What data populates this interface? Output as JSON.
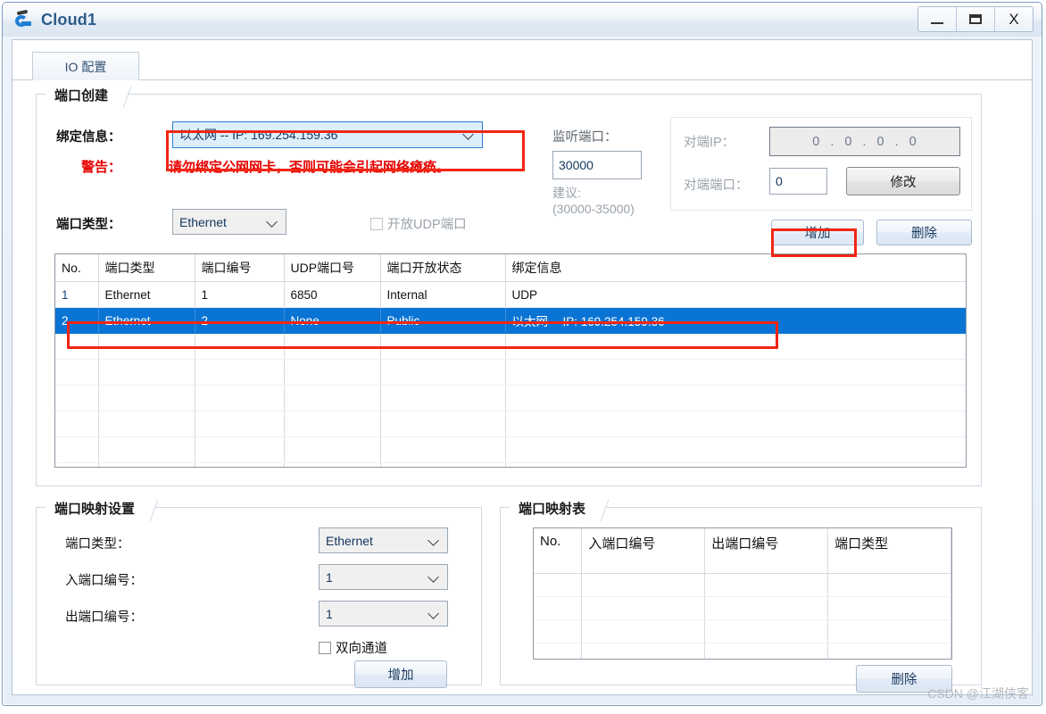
{
  "window": {
    "title": "Cloud1",
    "icon": "cloud-icon",
    "controls": {
      "minimize": "_",
      "maximize": "❐",
      "close": "X"
    }
  },
  "tabs": [
    {
      "label": "IO 配置",
      "active": true
    }
  ],
  "port_create": {
    "title": "端口创建",
    "binding_label": "绑定信息：",
    "binding_value": "以太网 -- IP: 169.254.159.36",
    "warning_label": "警告：",
    "warning_text": "请勿绑定公网网卡，否则可能会引起网络瘫痪。",
    "port_type_label": "端口类型：",
    "port_type_value": "Ethernet",
    "udp_checkbox_label": "开放UDP端口",
    "udp_checkbox_checked": false,
    "listen_port_label": "监听端口：",
    "listen_port_value": "30000",
    "suggest_label": "建议:",
    "suggest_range": "(30000-35000)",
    "peer_ip_label": "对端IP：",
    "peer_ip_octets": [
      "0",
      "0",
      "0",
      "0"
    ],
    "peer_port_label": "对端端口：",
    "peer_port_value": "0",
    "modify_button": "修改",
    "add_button": "增加",
    "delete_button": "删除"
  },
  "port_table": {
    "headers": [
      "No.",
      "端口类型",
      "端口编号",
      "UDP端口号",
      "端口开放状态",
      "绑定信息"
    ],
    "rows": [
      {
        "cells": [
          "1",
          "Ethernet",
          "1",
          "6850",
          "Internal",
          "UDP"
        ],
        "selected": false
      },
      {
        "cells": [
          "2",
          "Ethernet",
          "2",
          "None",
          "Public",
          "以太网 -- IP: 169.254.159.36"
        ],
        "selected": true
      }
    ],
    "empty_rows": 6
  },
  "port_map_settings": {
    "title": "端口映射设置",
    "port_type_label": "端口类型：",
    "port_type_value": "Ethernet",
    "in_port_label": "入端口编号：",
    "in_port_value": "1",
    "out_port_label": "出端口编号：",
    "out_port_value": "1",
    "bidirectional_label": "双向通道",
    "bidirectional_checked": false,
    "add_button": "增加"
  },
  "port_map_table": {
    "title": "端口映射表",
    "headers": [
      "No.",
      "入端口编号",
      "出端口编号",
      "端口类型"
    ],
    "rows": [],
    "empty_rows": 5,
    "delete_button": "删除"
  },
  "watermark": "CSDN @江湖侠客",
  "colors": {
    "accent": "#0a74d4",
    "highlight_red": "#f22613",
    "warning_red": "#e60000",
    "title_blue": "#2e5c8a"
  }
}
